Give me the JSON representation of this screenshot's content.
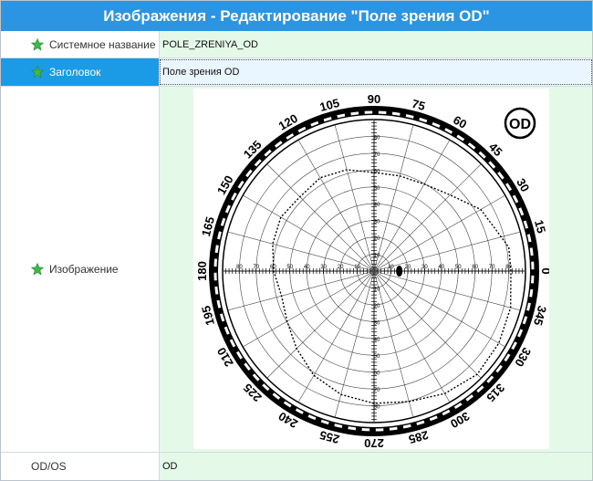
{
  "window": {
    "title": "Изображения - Редактирование \"Поле зрения OD\""
  },
  "rows": [
    {
      "label": "Системное название",
      "value": "POLE_ZRENIYA_OD"
    },
    {
      "label": "Заголовок",
      "value": "Поле зрения OD"
    },
    {
      "label": "Изображение"
    },
    {
      "label": "OD/OS",
      "value": "OD"
    }
  ],
  "chart": {
    "badge": "OD",
    "angle_labels": [
      "0",
      "15",
      "30",
      "45",
      "60",
      "75",
      "90",
      "105",
      "120",
      "135",
      "150",
      "165",
      "180",
      "195",
      "210",
      "225",
      "240",
      "255",
      "270",
      "285",
      "300",
      "315",
      "330",
      "345"
    ],
    "ring_values": [
      "10",
      "20",
      "30",
      "40",
      "50",
      "60",
      "70",
      "80"
    ]
  },
  "colors": {
    "title_bar": "#2b94e3",
    "selected_label": "#1b9be6",
    "value_bg": "#e5f9e8",
    "star": "#3fb94a"
  }
}
